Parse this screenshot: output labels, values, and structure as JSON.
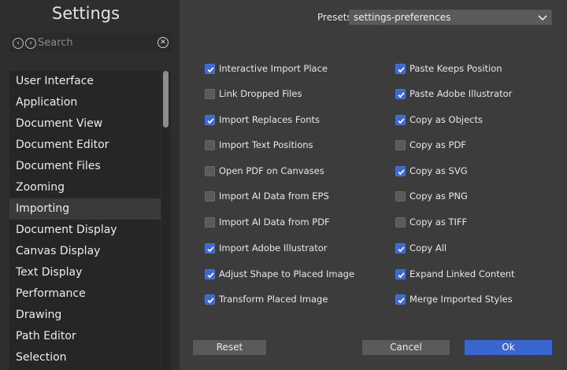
{
  "sidebar": {
    "title": "Settings",
    "search": {
      "placeholder": "Search",
      "value": ""
    },
    "items": [
      {
        "label": "User Interface",
        "selected": false
      },
      {
        "label": "Application",
        "selected": false
      },
      {
        "label": "Document View",
        "selected": false
      },
      {
        "label": "Document Editor",
        "selected": false
      },
      {
        "label": "Document Files",
        "selected": false
      },
      {
        "label": "Zooming",
        "selected": false
      },
      {
        "label": "Importing",
        "selected": true
      },
      {
        "label": "Document Display",
        "selected": false
      },
      {
        "label": "Canvas Display",
        "selected": false
      },
      {
        "label": "Text Display",
        "selected": false
      },
      {
        "label": "Performance",
        "selected": false
      },
      {
        "label": "Drawing",
        "selected": false
      },
      {
        "label": "Path Editor",
        "selected": false
      },
      {
        "label": "Selection",
        "selected": false
      }
    ]
  },
  "presets": {
    "label": "Presets",
    "value": "settings-preferences"
  },
  "options": {
    "left": [
      {
        "label": "Interactive Import Place",
        "checked": true
      },
      {
        "label": "Link Dropped Files",
        "checked": false
      },
      {
        "label": "Import Replaces Fonts",
        "checked": true
      },
      {
        "label": "Import Text Positions",
        "checked": false
      },
      {
        "label": "Open PDF on Canvases",
        "checked": false
      },
      {
        "label": "Import AI Data from EPS",
        "checked": false
      },
      {
        "label": "Import AI Data from PDF",
        "checked": false
      },
      {
        "label": "Import Adobe Illustrator",
        "checked": true
      },
      {
        "label": "Adjust Shape to Placed Image",
        "checked": true
      },
      {
        "label": "Transform Placed Image",
        "checked": true
      }
    ],
    "right": [
      {
        "label": "Paste Keeps Position",
        "checked": true
      },
      {
        "label": "Paste Adobe Illustrator",
        "checked": true
      },
      {
        "label": "Copy as Objects",
        "checked": true
      },
      {
        "label": "Copy as PDF",
        "checked": false
      },
      {
        "label": "Copy as SVG",
        "checked": true
      },
      {
        "label": "Copy as PNG",
        "checked": false
      },
      {
        "label": "Copy as TIFF",
        "checked": false
      },
      {
        "label": "Copy All",
        "checked": true
      },
      {
        "label": "Expand Linked Content",
        "checked": true
      },
      {
        "label": "Merge Imported Styles",
        "checked": true
      }
    ]
  },
  "buttons": {
    "reset": "Reset",
    "cancel": "Cancel",
    "ok": "Ok"
  },
  "colors": {
    "accent": "#3d68cc",
    "sidebar_bg": "#2e2e2e",
    "panel_bg": "#3c3c3c"
  }
}
